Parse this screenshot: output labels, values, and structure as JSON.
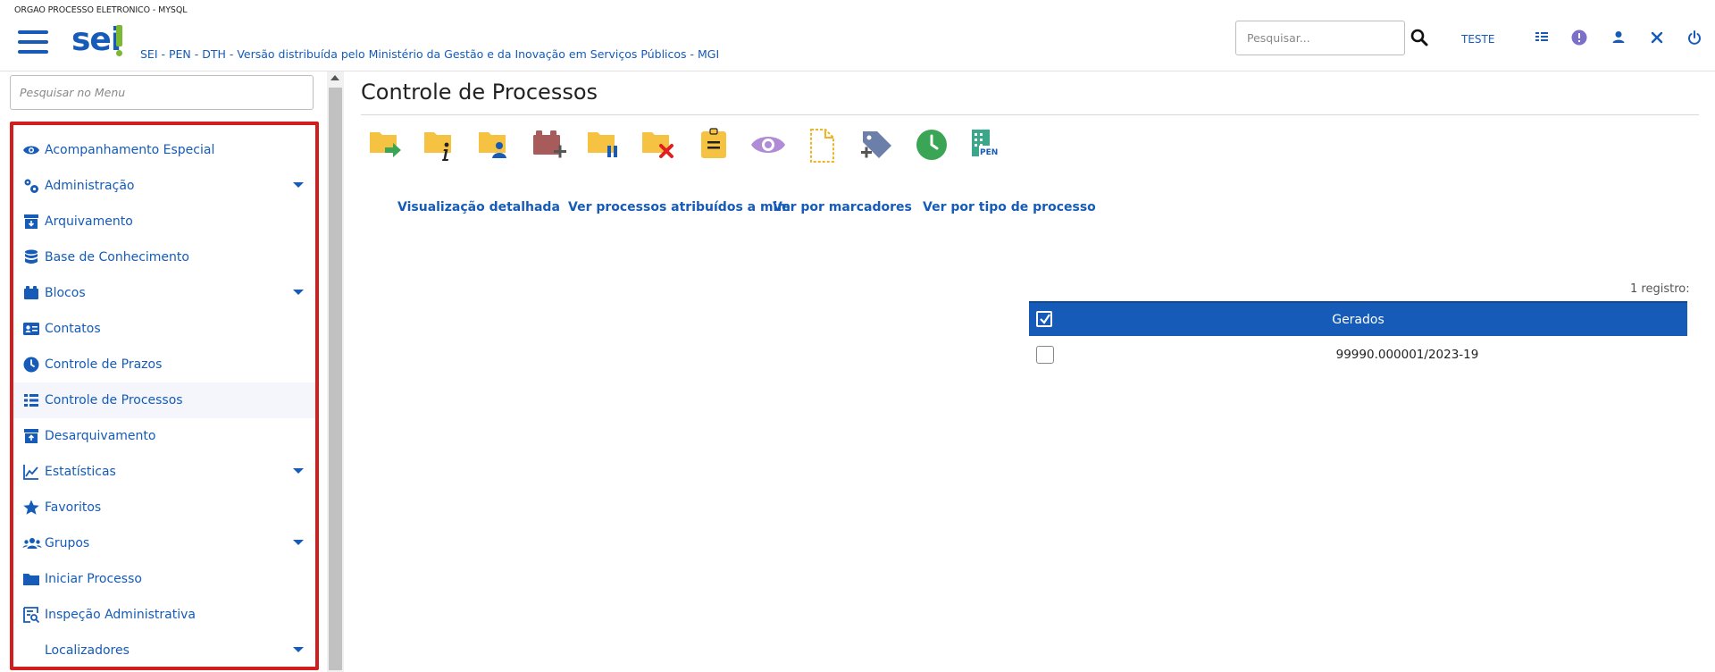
{
  "header": {
    "org_name": "ORGAO PROCESSO ELETRONICO - MYSQL",
    "logo_text": "sei",
    "system_name": "SEI - PEN - DTH - Versão distribuída pelo Ministério da Gestão e da Inovação em Serviços Públicos - MGI",
    "search_placeholder": "Pesquisar...",
    "user_label": "TESTE",
    "icons": [
      "search-icon",
      "grid-icon",
      "info-icon",
      "user-icon",
      "tools-icon",
      "power-icon"
    ]
  },
  "sidebar": {
    "search_placeholder": "Pesquisar no Menu",
    "items": [
      {
        "label": "Acompanhamento Especial",
        "icon": "eye-icon",
        "submenu": false
      },
      {
        "label": "Administração",
        "icon": "gears-icon",
        "submenu": true
      },
      {
        "label": "Arquivamento",
        "icon": "archive-icon",
        "submenu": false
      },
      {
        "label": "Base de Conhecimento",
        "icon": "database-icon",
        "submenu": false
      },
      {
        "label": "Blocos",
        "icon": "blocks-icon",
        "submenu": true
      },
      {
        "label": "Contatos",
        "icon": "contact-card-icon",
        "submenu": false
      },
      {
        "label": "Controle de Prazos",
        "icon": "clock-icon",
        "submenu": false
      },
      {
        "label": "Controle de Processos",
        "icon": "list-icon",
        "submenu": false,
        "active": true
      },
      {
        "label": "Desarquivamento",
        "icon": "unarchive-icon",
        "submenu": false
      },
      {
        "label": "Estatísticas",
        "icon": "line-chart-icon",
        "submenu": true
      },
      {
        "label": "Favoritos",
        "icon": "star-icon",
        "submenu": false
      },
      {
        "label": "Grupos",
        "icon": "users-icon",
        "submenu": true
      },
      {
        "label": "Iniciar Processo",
        "icon": "folder-icon",
        "submenu": false
      },
      {
        "label": "Inspeção Administrativa",
        "icon": "inspection-icon",
        "submenu": false
      },
      {
        "label": "Localizadores",
        "icon": "",
        "submenu": true
      }
    ]
  },
  "main": {
    "title": "Controle de Processos",
    "toolbar": [
      "send-process-icon",
      "process-info-icon",
      "assign-process-icon",
      "add-to-block-icon",
      "pause-process-icon",
      "close-process-icon",
      "notes-icon",
      "view-icon",
      "document-icon",
      "add-marker-icon",
      "deadline-icon",
      "pen-icon"
    ],
    "view_links": [
      "Visualização detalhada",
      "Ver processos atribuídos a mim",
      "Ver por marcadores",
      "Ver por tipo de processo"
    ],
    "records_text": "1 registro:",
    "table": {
      "header": "Gerados",
      "rows": [
        "99990.000001/2023-19"
      ]
    }
  },
  "colors": {
    "primary": "#155bb7",
    "logo_green": "#7db832",
    "highlight_border": "#d11f1f",
    "folder_yellow": "#f5c242"
  }
}
